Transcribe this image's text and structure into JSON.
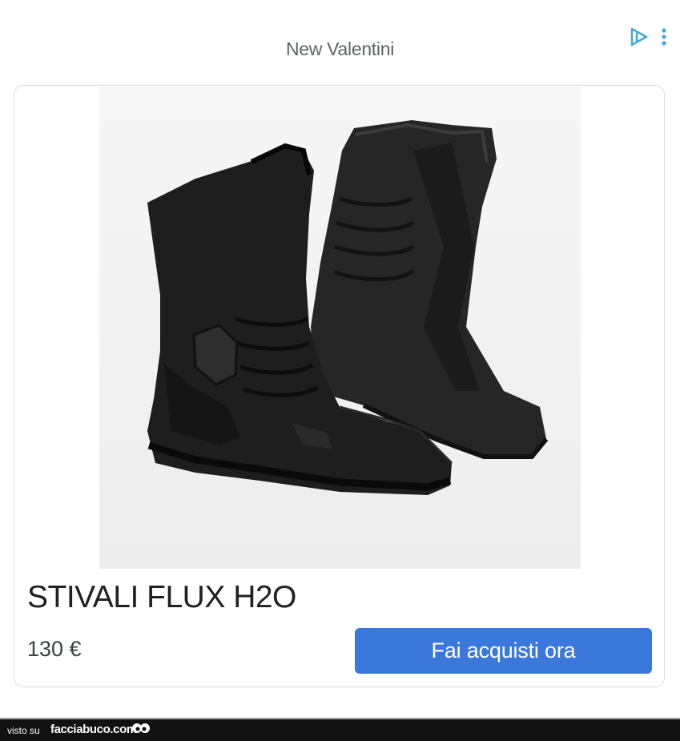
{
  "ad": {
    "advertiser": "New Valentini",
    "adchoices_icon": "adchoices-play-icon",
    "more_icon": "more-vert-icon",
    "accent_color": "#3a78db"
  },
  "product": {
    "image": "black-motorcycle-boots",
    "title": "STIVALI FLUX H2O",
    "price": "130 €",
    "cta_label": "Fai acquisti ora"
  },
  "watermark": {
    "prefix": "visto su",
    "site": "facciabuco.com"
  }
}
